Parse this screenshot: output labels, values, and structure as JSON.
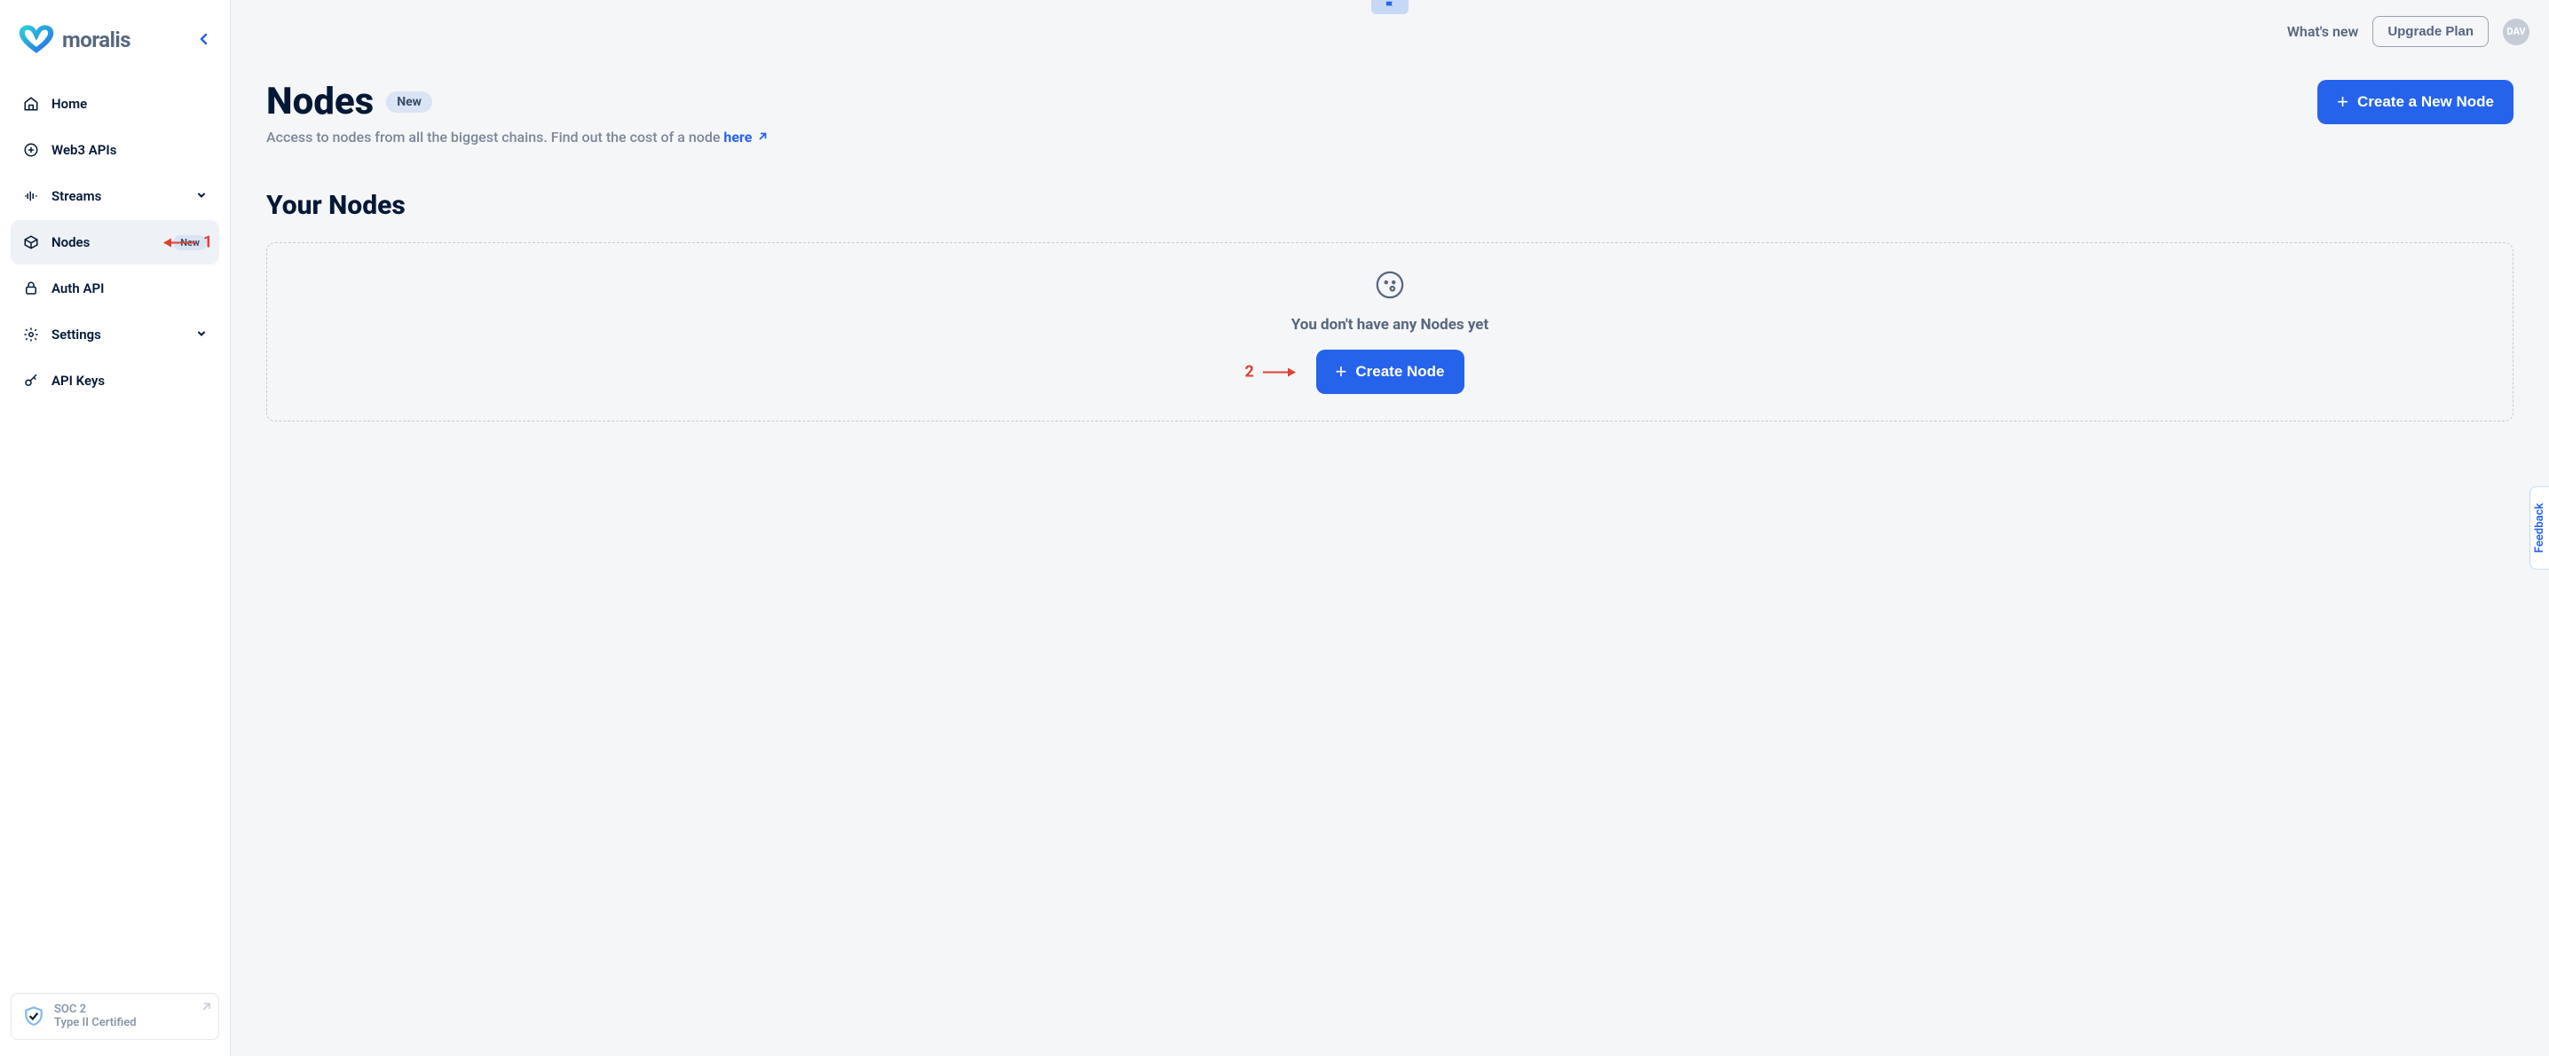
{
  "brand": "moralis",
  "sidebar": {
    "items": [
      {
        "label": "Home"
      },
      {
        "label": "Web3 APIs"
      },
      {
        "label": "Streams"
      },
      {
        "label": "Nodes",
        "badge": "New"
      },
      {
        "label": "Auth API"
      },
      {
        "label": "Settings"
      },
      {
        "label": "API Keys"
      }
    ],
    "soc": {
      "line1": "SOC 2",
      "line2": "Type II Certified"
    }
  },
  "topbar": {
    "whats_new": "What's new",
    "upgrade": "Upgrade Plan",
    "avatar": "DAV"
  },
  "page": {
    "title": "Nodes",
    "title_badge": "New",
    "subtitle_prefix": "Access to nodes from all the biggest chains. Find out the cost of a node ",
    "subtitle_link": "here",
    "create_top": "Create a New Node"
  },
  "section": {
    "title": "Your Nodes",
    "empty_text": "You don't have any Nodes yet",
    "create_btn": "Create Node"
  },
  "annotations": {
    "one": "1",
    "two": "2"
  },
  "feedback": "Feedback"
}
